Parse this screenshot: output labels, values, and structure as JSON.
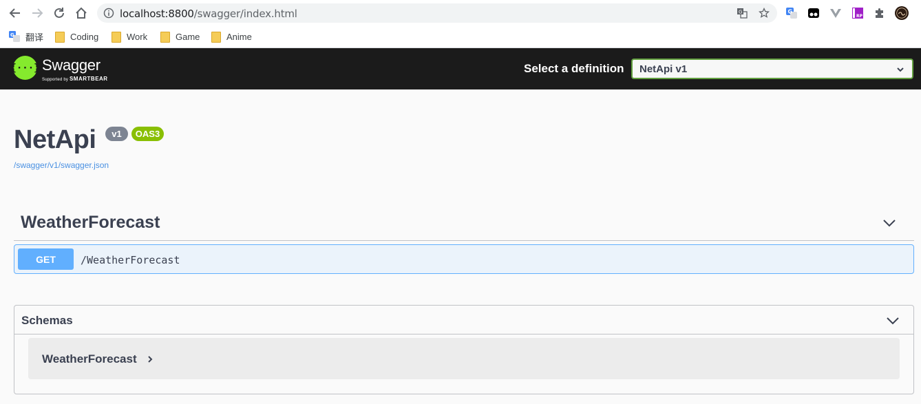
{
  "browser": {
    "url_host": "localhost:8800",
    "url_path": "/swagger/index.html",
    "bookmarks": [
      {
        "label": "翻译",
        "icon": "translate-icon"
      },
      {
        "label": "Coding",
        "icon": "folder-icon"
      },
      {
        "label": "Work",
        "icon": "folder-icon"
      },
      {
        "label": "Game",
        "icon": "folder-icon"
      },
      {
        "label": "Anime",
        "icon": "folder-icon"
      }
    ]
  },
  "topbar": {
    "logo_text": "Swagger",
    "logo_sub_prefix": "Supported by",
    "logo_sub_brand": "SMARTBEAR",
    "definition_label": "Select a definition",
    "definition_selected": "NetApi v1"
  },
  "info": {
    "title": "NetApi",
    "version_badge": "v1",
    "oas_badge": "OAS3",
    "spec_link": "/swagger/v1/swagger.json"
  },
  "tags": [
    {
      "name": "WeatherForecast",
      "operations": [
        {
          "method": "GET",
          "path": "/WeatherForecast"
        }
      ]
    }
  ],
  "schemas": {
    "label": "Schemas",
    "models": [
      {
        "name": "WeatherForecast"
      }
    ]
  },
  "colors": {
    "topbar_bg": "#1b1b1b",
    "swagger_green": "#85ea2d",
    "get_blue": "#61affe",
    "oas_green": "#89bf04",
    "text_dark": "#3b4151"
  }
}
